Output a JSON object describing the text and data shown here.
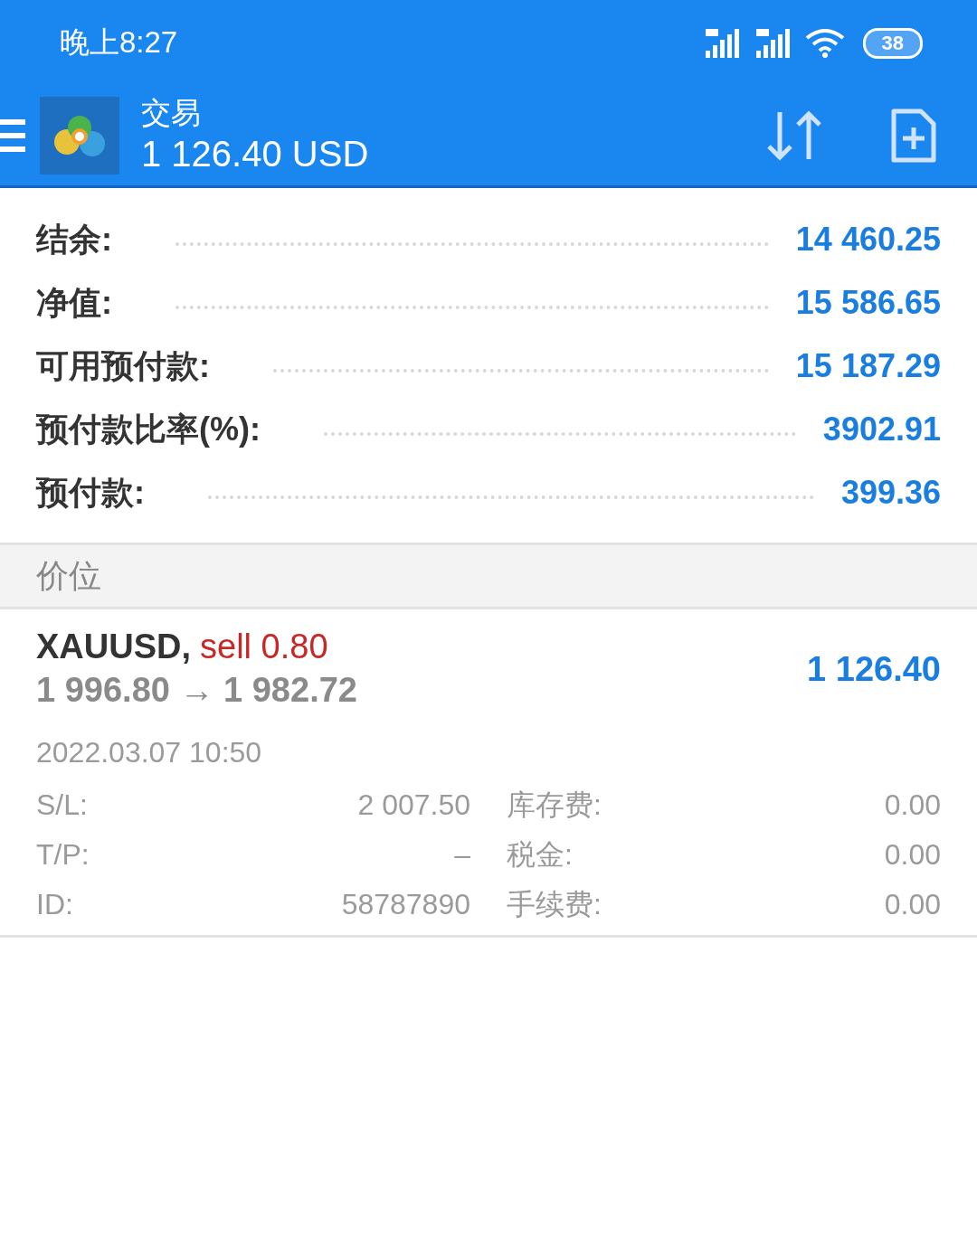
{
  "status_bar": {
    "time": "晚上8:27",
    "battery": "38"
  },
  "app_bar": {
    "title": "交易",
    "subtitle": "1 126.40 USD"
  },
  "summary": [
    {
      "label": "结余:",
      "value": "14 460.25"
    },
    {
      "label": "净值:",
      "value": "15 586.65"
    },
    {
      "label": "可用预付款:",
      "value": "15 187.29"
    },
    {
      "label": "预付款比率(%):",
      "value": "3902.91"
    },
    {
      "label": "预付款:",
      "value": "399.36"
    }
  ],
  "section": {
    "title": "价位"
  },
  "positions": [
    {
      "symbol": "XAUUSD,",
      "kind": "sell",
      "trade": "sell 0.80",
      "prices": "1 996.80 → 1 982.72",
      "profit": "1 126.40",
      "time": "2022.03.07 10:50",
      "details": [
        {
          "label": "S/L:",
          "value": "2 007.50",
          "label2": "库存费:",
          "value2": "0.00"
        },
        {
          "label": "T/P:",
          "value": "–",
          "label2": "税金:",
          "value2": "0.00"
        },
        {
          "label": "ID:",
          "value": "58787890",
          "label2": "手续费:",
          "value2": "0.00"
        }
      ]
    }
  ]
}
